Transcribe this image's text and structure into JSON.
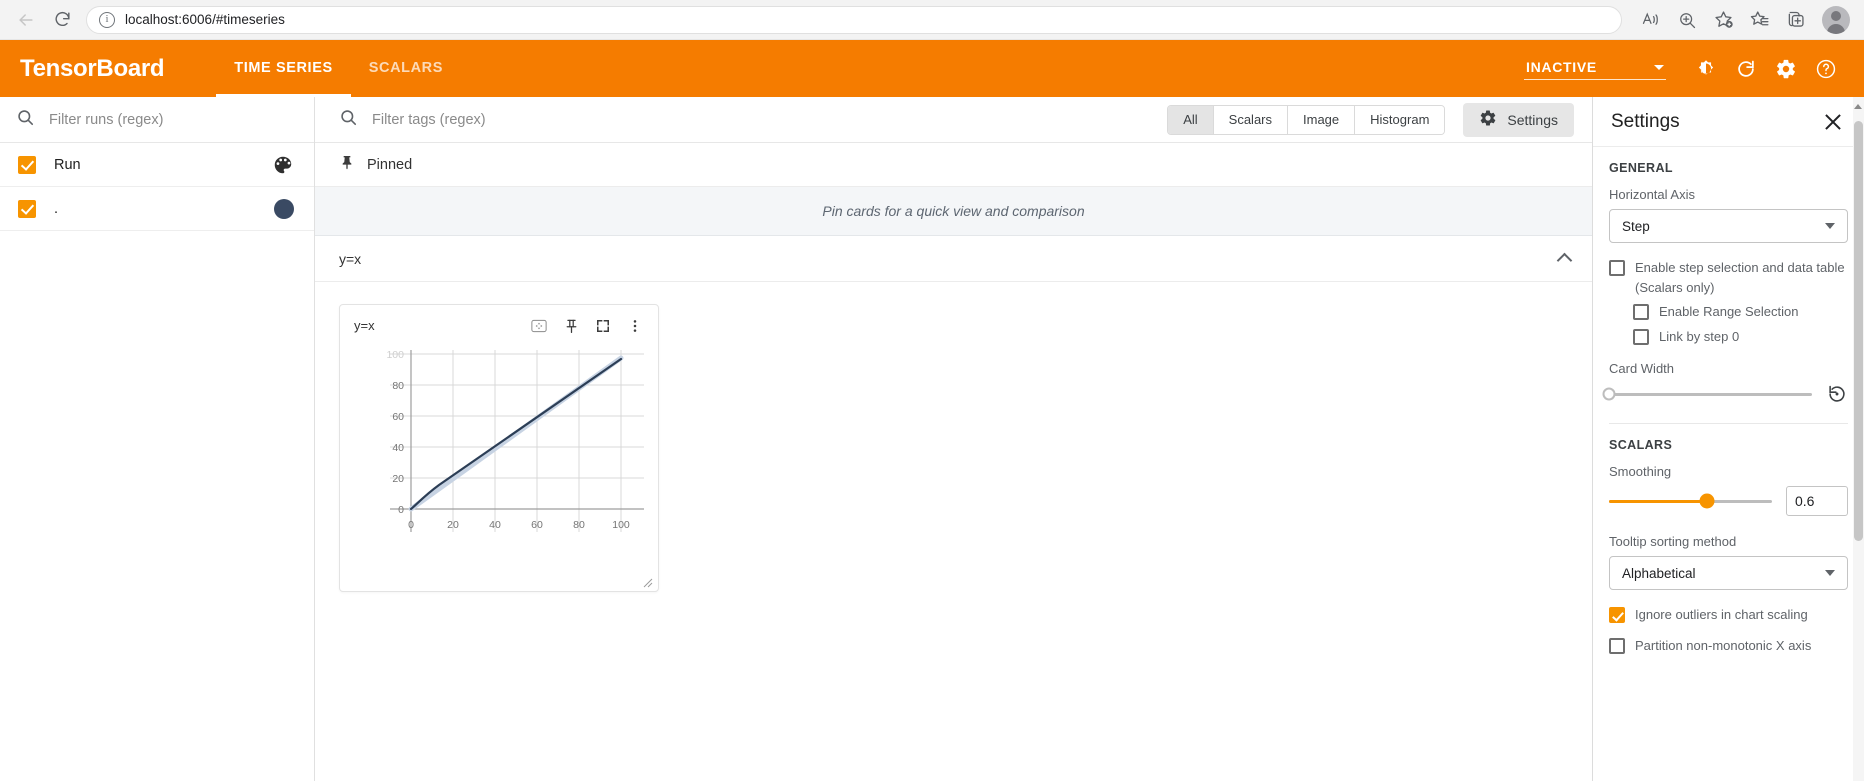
{
  "browser": {
    "back_icon": "back-arrow-icon",
    "reload_icon": "reload-icon",
    "info_icon": "site-info-icon",
    "url": "localhost:6006/#timeseries",
    "read_aloud_icon": "read-aloud-icon",
    "zoom_icon": "zoom-icon",
    "add_favorite_icon": "add-favorite-icon",
    "favorites_icon": "favorites-icon",
    "collections_icon": "collections-icon",
    "profile_icon": "profile-avatar-icon"
  },
  "header": {
    "logo": "TensorBoard",
    "tabs": [
      {
        "label": "TIME SERIES",
        "active": true
      },
      {
        "label": "SCALARS",
        "active": false
      }
    ],
    "reload_status": "INACTIVE",
    "brightness_icon": "brightness-icon",
    "refresh_icon": "refresh-icon",
    "settings_icon": "gear-icon",
    "help_icon": "help-icon",
    "accent_color": "#f57c00"
  },
  "runs_pane": {
    "filter_placeholder": "Filter runs (regex)",
    "search_icon": "search-icon",
    "runs": [
      {
        "name": "Run",
        "checked": true,
        "right_icon": "color-palette-icon",
        "color": null
      },
      {
        "name": ".",
        "checked": true,
        "right_icon": "run-color-dot",
        "color": "#3a4a63"
      }
    ]
  },
  "tag_toolbar": {
    "filter_placeholder": "Filter tags (regex)",
    "search_icon": "search-icon",
    "plugin_filters": [
      {
        "label": "All",
        "selected": true
      },
      {
        "label": "Scalars",
        "selected": false
      },
      {
        "label": "Image",
        "selected": false
      },
      {
        "label": "Histogram",
        "selected": false
      }
    ],
    "settings_button": {
      "label": "Settings",
      "icon": "gear-icon"
    }
  },
  "content": {
    "pinned": {
      "icon": "pin-icon",
      "label": "Pinned",
      "empty_text": "Pin cards for a quick view and comparison"
    },
    "group": {
      "title": "y=x",
      "collapse_icon": "chevron-up-icon"
    },
    "card": {
      "title": "y=x",
      "actions": [
        {
          "icon": "fit-to-domain-icon"
        },
        {
          "icon": "pin-icon"
        },
        {
          "icon": "fullscreen-icon"
        },
        {
          "icon": "more-vert-icon"
        }
      ],
      "resize_grip_icon": "resize-grip-icon"
    }
  },
  "chart_data": {
    "type": "line",
    "title": "y=x",
    "xlabel": "",
    "ylabel": "",
    "xlim": [
      -10,
      112
    ],
    "ylim": [
      -18,
      104
    ],
    "xticks": [
      0,
      20,
      40,
      60,
      80,
      100
    ],
    "yticks": [
      0,
      20,
      40,
      60,
      80,
      100
    ],
    "grid": true,
    "legend": "none",
    "series": [
      {
        "name": "y=x",
        "color": "#2c3e56",
        "halo_color": "#c7d3e3",
        "x": [
          0,
          10,
          20,
          30,
          40,
          50,
          60,
          70,
          80,
          90,
          99
        ],
        "y": [
          0,
          10,
          20,
          30,
          40,
          50,
          60,
          70,
          80,
          90,
          99
        ]
      }
    ]
  },
  "settings": {
    "title": "Settings",
    "close_icon": "close-icon",
    "general": {
      "section": "GENERAL",
      "horizontal_axis_label": "Horizontal Axis",
      "horizontal_axis_value": "Step",
      "checkboxes": [
        {
          "label": "Enable step selection and data table",
          "checked": false,
          "note": "(Scalars only)"
        },
        {
          "label": "Enable Range Selection",
          "checked": false,
          "indent": true
        },
        {
          "label": "Link by step 0",
          "checked": false,
          "indent": true
        }
      ],
      "card_width_label": "Card Width",
      "card_width_value": 0,
      "reset_icon": "reset-icon"
    },
    "scalars": {
      "section": "SCALARS",
      "smoothing_label": "Smoothing",
      "smoothing_value": "0.6",
      "smoothing_fill_pct": 60,
      "tooltip_sort_label": "Tooltip sorting method",
      "tooltip_sort_value": "Alphabetical",
      "checkboxes": [
        {
          "label": "Ignore outliers in chart scaling",
          "checked": true
        },
        {
          "label": "Partition non-monotonic X axis",
          "checked": false
        }
      ]
    },
    "scrollbar": {
      "up_arrow_icon": "scroll-up-arrow-icon"
    }
  }
}
